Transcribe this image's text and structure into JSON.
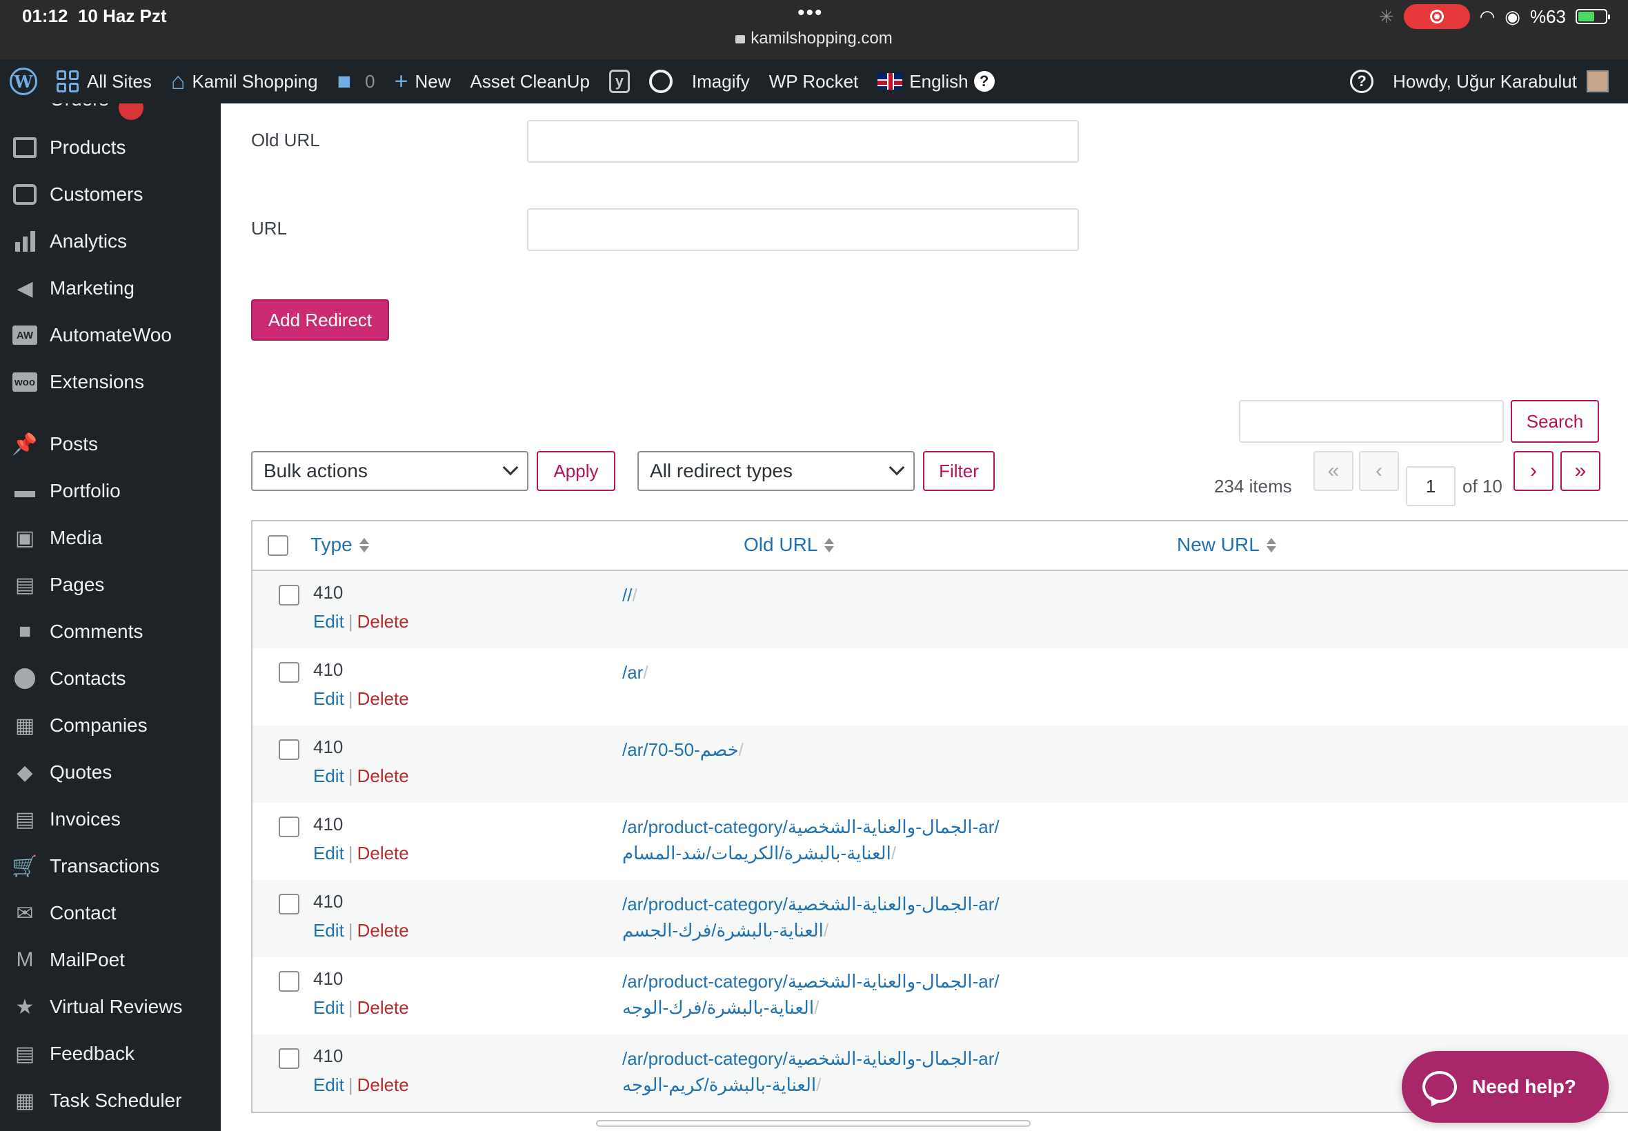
{
  "status_bar": {
    "time": "01:12",
    "date": "10 Haz Pzt",
    "url": "kamilshopping.com",
    "battery": "%63"
  },
  "admin_bar": {
    "all_sites": "All Sites",
    "site_name": "Kamil Shopping",
    "comments_count": "0",
    "new_label": "New",
    "asset_cleanup": "Asset CleanUp",
    "imagify": "Imagify",
    "wp_rocket": "WP Rocket",
    "language": "English",
    "howdy": "Howdy, Uğur Karabulut"
  },
  "sidebar": {
    "items": [
      {
        "label": "Products",
        "icon": "box-icon"
      },
      {
        "label": "Customers",
        "icon": "customers-icon"
      },
      {
        "label": "Analytics",
        "icon": "bar-chart-icon"
      },
      {
        "label": "Marketing",
        "icon": "megaphone-icon"
      },
      {
        "label": "AutomateWoo",
        "icon": "aw-icon"
      },
      {
        "label": "Extensions",
        "icon": "woo-icon"
      },
      {
        "label": "Posts",
        "icon": "pin-icon"
      },
      {
        "label": "Portfolio",
        "icon": "folder-icon"
      },
      {
        "label": "Media",
        "icon": "media-icon"
      },
      {
        "label": "Pages",
        "icon": "pages-icon"
      },
      {
        "label": "Comments",
        "icon": "comment-icon"
      },
      {
        "label": "Contacts",
        "icon": "person-icon"
      },
      {
        "label": "Companies",
        "icon": "store-icon"
      },
      {
        "label": "Quotes",
        "icon": "tag-icon"
      },
      {
        "label": "Invoices",
        "icon": "document-icon"
      },
      {
        "label": "Transactions",
        "icon": "cart-icon"
      },
      {
        "label": "Contact",
        "icon": "mail-icon"
      },
      {
        "label": "MailPoet",
        "icon": "mailpoet-icon"
      },
      {
        "label": "Virtual Reviews",
        "icon": "star-icon"
      },
      {
        "label": "Feedback",
        "icon": "feedback-icon"
      },
      {
        "label": "Task Scheduler",
        "icon": "calendar-icon"
      }
    ]
  },
  "form": {
    "old_url_label": "Old URL",
    "url_label": "URL",
    "add_button": "Add Redirect"
  },
  "toolbar": {
    "bulk_actions": "Bulk actions",
    "apply": "Apply",
    "redirect_types": "All redirect types",
    "filter": "Filter",
    "search": "Search",
    "items_count": "234 items",
    "current_page": "1",
    "of_pages": "of 10",
    "first": "«",
    "prev": "‹",
    "next": "›",
    "last": "»"
  },
  "table": {
    "columns": [
      "Type",
      "Old URL",
      "New URL"
    ],
    "edit_label": "Edit",
    "delete_label": "Delete",
    "rows": [
      {
        "type": "410",
        "old_url": "//",
        "tail": "/"
      },
      {
        "type": "410",
        "old_url": "/ar",
        "tail": "/"
      },
      {
        "type": "410",
        "old_url": "/ar/70-50-خصم",
        "tail": "/"
      },
      {
        "type": "410",
        "old_url_line1": "/ar/product-category/الجمال-والعناية-الشخصية-ar/",
        "old_url_line2": "العناية-بالبشرة/الكريمات/شد-المسام",
        "tail": "/"
      },
      {
        "type": "410",
        "old_url_line1": "/ar/product-category/الجمال-والعناية-الشخصية-ar/",
        "old_url_line2": "العناية-بالبشرة/فرك-الجسم",
        "tail": "/"
      },
      {
        "type": "410",
        "old_url_line1": "/ar/product-category/الجمال-والعناية-الشخصية-ar/",
        "old_url_line2": "العناية-بالبشرة/فرك-الوجه",
        "tail": "/"
      },
      {
        "type": "410",
        "old_url_line1": "/ar/product-category/الجمال-والعناية-الشخصية-ar/",
        "old_url_line2": "العناية-بالبشرة/كريم-الوجه",
        "tail": "/"
      }
    ]
  },
  "help_button": "Need help?",
  "colors": {
    "admin_bar_bg": "#1d2327",
    "accent_pink": "#cc2a73",
    "link_blue": "#2271b1"
  }
}
